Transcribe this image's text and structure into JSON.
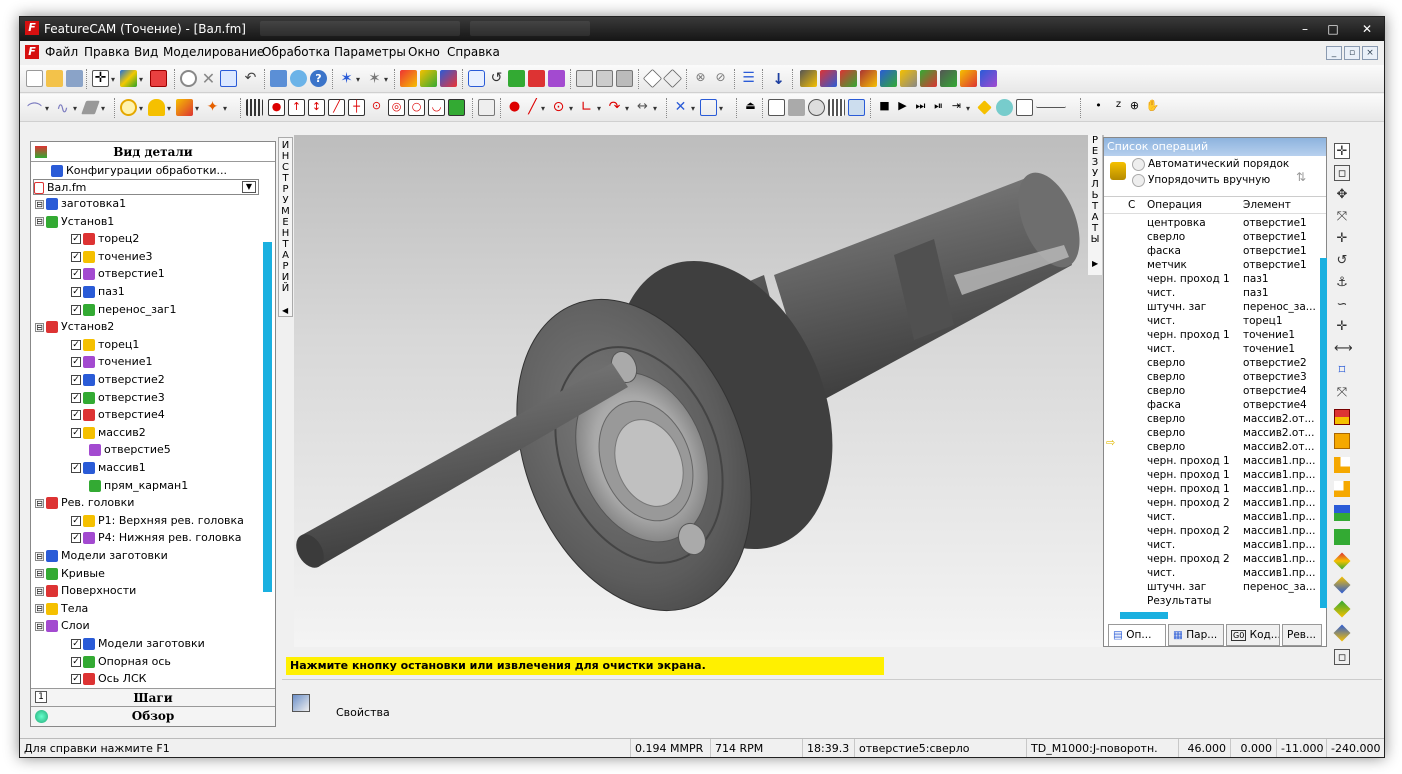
{
  "window": {
    "title": "FeatureCAM (Точение) - [Вал.fm]",
    "controls": [
      "–",
      "□",
      "✕"
    ]
  },
  "menu": {
    "items": [
      "Файл",
      "Правка",
      "Вид",
      "Моделирование",
      "Обработка",
      "Параметры",
      "Окно",
      "Справка"
    ],
    "mdi_controls": [
      "_",
      "▫",
      "×"
    ]
  },
  "left_panel": {
    "header": "Вид детали",
    "config_item": "Конфигурации обработки...",
    "file": "Вал.fm",
    "tree": [
      {
        "label": "заготовка1",
        "level": 1
      },
      {
        "label": "Установ1",
        "level": 1
      },
      {
        "label": "торец2",
        "level": 2
      },
      {
        "label": "точение3",
        "level": 2
      },
      {
        "label": "отверстие1",
        "level": 2
      },
      {
        "label": "паз1",
        "level": 2
      },
      {
        "label": "перенос_заг1",
        "level": 2
      },
      {
        "label": "Установ2",
        "level": 1
      },
      {
        "label": "торец1",
        "level": 2
      },
      {
        "label": "точение1",
        "level": 2
      },
      {
        "label": "отверстие2",
        "level": 2
      },
      {
        "label": "отверстие3",
        "level": 2
      },
      {
        "label": "отверстие4",
        "level": 2
      },
      {
        "label": "массив2",
        "level": 2
      },
      {
        "label": "отверстие5",
        "level": 3
      },
      {
        "label": "массив1",
        "level": 2
      },
      {
        "label": "прям_карман1",
        "level": 3
      },
      {
        "label": "Рев. головки",
        "level": 1
      },
      {
        "label": "P1: Верхняя рев. головка",
        "level": 2
      },
      {
        "label": "P4: Нижняя рев. головка",
        "level": 2
      },
      {
        "label": "Модели заготовки",
        "level": 1
      },
      {
        "label": "Кривые",
        "level": 1
      },
      {
        "label": "Поверхности",
        "level": 1
      },
      {
        "label": "Тела",
        "level": 1
      },
      {
        "label": "Слои",
        "level": 1
      },
      {
        "label": "Модели заготовки",
        "level": 2
      },
      {
        "label": "Опорная ось",
        "level": 2
      },
      {
        "label": "Ось ЛСК",
        "level": 2
      }
    ],
    "bottom_tabs": [
      "Шаги",
      "Обзор"
    ]
  },
  "side_tab_left": "ИНСТРУМЕНТАРИЙ",
  "side_tab_right": "РЕЗУЛЬТАТЫ",
  "operations": {
    "title": "Список операций",
    "order_auto": "Автоматический порядок",
    "order_manual": "Упорядочить вручную",
    "columns": [
      "С",
      "Операция",
      "Элемент"
    ],
    "rows": [
      [
        "центровка",
        "отверстие1"
      ],
      [
        "сверло",
        "отверстие1"
      ],
      [
        "фаска",
        "отверстие1"
      ],
      [
        "метчик",
        "отверстие1"
      ],
      [
        "черн. проход 1",
        "паз1"
      ],
      [
        "чист.",
        "паз1"
      ],
      [
        "штучн. заг",
        "перенос_за..."
      ],
      [
        "чист.",
        "торец1"
      ],
      [
        "черн. проход 1",
        "точение1"
      ],
      [
        "чист.",
        "точение1"
      ],
      [
        "сверло",
        "отверстие2"
      ],
      [
        "сверло",
        "отверстие3"
      ],
      [
        "сверло",
        "отверстие4"
      ],
      [
        "фаска",
        "отверстие4"
      ],
      [
        "сверло",
        "массив2.от..."
      ],
      [
        "сверло",
        "массив2.от..."
      ],
      [
        "сверло",
        "массив2.от..."
      ],
      [
        "черн. проход 1",
        "массив1.пр..."
      ],
      [
        "черн. проход 1",
        "массив1.пр..."
      ],
      [
        "черн. проход 1",
        "массив1.пр..."
      ],
      [
        "черн. проход 2",
        "массив1.пр..."
      ],
      [
        "чист.",
        "массив1.пр..."
      ],
      [
        "черн. проход 2",
        "массив1.пр..."
      ],
      [
        "чист.",
        "массив1.пр..."
      ],
      [
        "черн. проход 2",
        "массив1.пр..."
      ],
      [
        "чист.",
        "массив1.пр..."
      ],
      [
        "штучн. заг",
        "перенос_за..."
      ],
      [
        "Результаты",
        ""
      ]
    ],
    "tabs": [
      "Оп...",
      "Пар...",
      "Код...",
      "Рев..."
    ]
  },
  "message": "Нажмите кнопку остановки или извлечения для очистки экрана.",
  "properties_label": "Свойства",
  "status": {
    "help": "Для справки нажмите F1",
    "feed": "0.194 MMPR",
    "rpm": "714 RPM",
    "time": "18:39.3",
    "current": "отверстие5:сверло",
    "tool": "TD_M1000:J-поворотн.",
    "x": "46.000",
    "y": "0.000",
    "z": "-11.000",
    "w": "-240.000"
  },
  "colors": {
    "accent": "#1ab0e0",
    "message_bg": "#fff000",
    "title_bar": "#1e1e1e"
  }
}
